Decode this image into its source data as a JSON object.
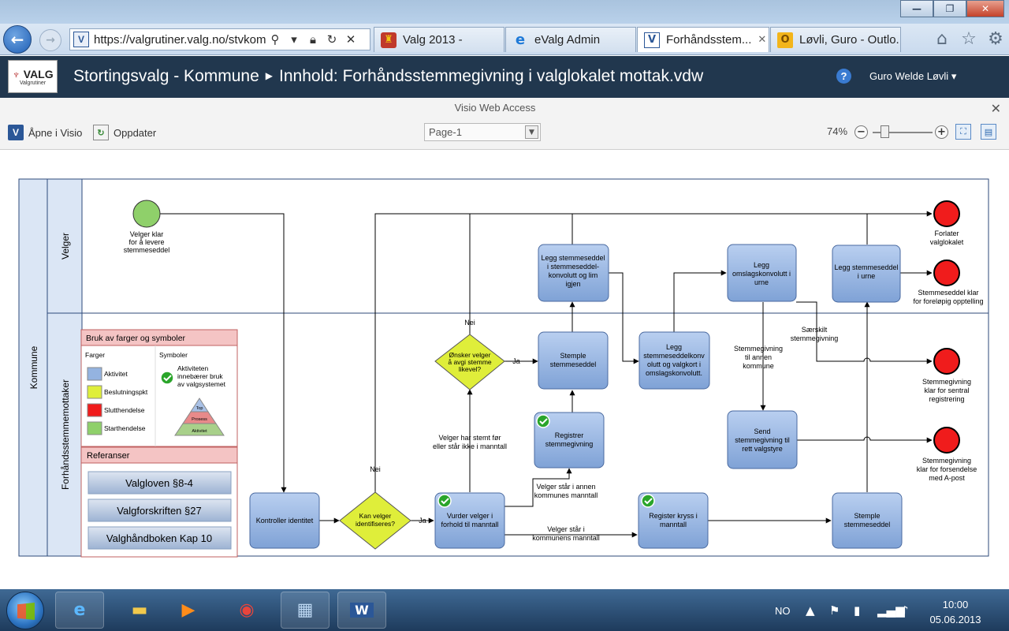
{
  "browser": {
    "url": "https://valgrutiner.valg.no/stvkom",
    "tabs": [
      {
        "label": "Valg 2013 -",
        "icon": "coat-of-arms-icon"
      },
      {
        "label": "eValg Admin",
        "icon": "ie-icon"
      },
      {
        "label": "Forhåndsstem...",
        "icon": "visio-icon",
        "active": true
      },
      {
        "label": "Løvli, Guro - Outlo...",
        "icon": "outlook-icon"
      }
    ]
  },
  "sharepoint": {
    "logo_text": "VALG",
    "logo_sub": "Valgrutiner",
    "breadcrumb_site": "Stortingsvalg - Kommune",
    "breadcrumb_page": "Innhold: Forhåndsstemmegivning i valglokalet mottak.vdw",
    "user": "Guro Welde Løvli"
  },
  "vwa": {
    "title": "Visio Web Access",
    "open_label": "Åpne i Visio",
    "refresh_label": "Oppdater",
    "page": "Page-1",
    "zoom": "74%",
    "zoom_level": 0.2
  },
  "diagram": {
    "pool": "Kommune",
    "lane_top": "Velger",
    "lane_bottom": "Forhåndsstemmemottaker",
    "start": "Velger klar\nfor å levere\nstemmeseddel",
    "tasks": {
      "kontroller": "Kontroller identitet",
      "vurder": "Vurder velger i\nforhold til manntall",
      "registrer_stemmegivning": "Registrer\nstemmegivning",
      "stemple1": "Stemple\nstemmeseddel",
      "legg_konvolutt": "Legg stemmeseddel\ni stemmeseddel-\nkonvolutt og lim\nigjen",
      "legg_omslag": "Legg\nstemmeseddelkonv\nolutt og valgkort i\nomslagskonvolutt.",
      "legg_omslag_urne": "Legg\nomslagskonvolutt i\nurne",
      "send": "Send\nstemmegivning til\nrett valgstyre",
      "register_kryss": "Register kryss i\nmanntall",
      "stemple2": "Stemple\nstemmeseddel",
      "legg_urne": "Legg stemmeseddel\ni urne"
    },
    "gateways": {
      "identifiseres": "Kan velger\nidentifiseres?",
      "onsker": "Ønsker velger\nå avgi stemme\nlikevel?"
    },
    "ends": {
      "forlater": "Forlater\nvalglokalet",
      "opptelling": "Stemmeseddel klar\nfor foreløpig opptelling",
      "sentral": "Stemmegivning\nklar for sentral\nregistrering",
      "forsendelse": "Stemmegivning\nklar for forsendelse\nmed A-post"
    },
    "edge_labels": {
      "ja1": "Ja",
      "nei1": "Nei",
      "ja2": "Ja",
      "nei2": "Nei",
      "har_stemt": "Velger har stemt før\neller står ikke i manntall",
      "annen_kommune": "Velger står i annen\nkommunes manntall",
      "kommunens": "Velger står i\nkommunens manntall",
      "til_annen": "Stemmegivning\ntil annen\nkommune",
      "saerskilt": "Særskilt\nstemmegivning"
    },
    "legend": {
      "title": "Bruk av farger og symboler",
      "farger": "Farger",
      "symboler": "Symboler",
      "items": [
        {
          "label": "Aktivitet",
          "color": "#94b3e0"
        },
        {
          "label": "Beslutningspkt",
          "color": "#dfee3a"
        },
        {
          "label": "Slutthendelse",
          "color": "#f01c1c"
        },
        {
          "label": "Starthendelse",
          "color": "#8fd06a"
        }
      ],
      "symbol_text": "Aktiviteten\ninnebærer bruk\nav valgsystemet",
      "pyramid": [
        "Top",
        "Prosess",
        "Aktivitet"
      ]
    },
    "references": {
      "title": "Referanser",
      "items": [
        "Valgloven §8-4",
        "Valgforskriften §27",
        "Valghåndboken Kap 10"
      ]
    }
  },
  "taskbar": {
    "lang": "NO",
    "time": "10:00",
    "date": "05.06.2013"
  },
  "colors": {
    "task_fill": "#94b3e0",
    "gateway_fill": "#dfee3a",
    "end_fill": "#f01c1c",
    "start_fill": "#8fd06a",
    "header_bg": "#21374e"
  }
}
